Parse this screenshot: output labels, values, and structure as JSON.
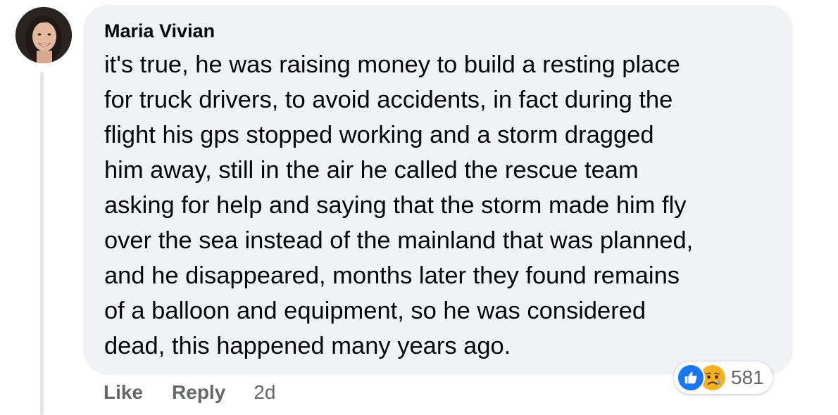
{
  "comment": {
    "author": "Maria Vivian",
    "avatar_icon": "profile-photo",
    "text_lines": [
      "it's true, he was raising money to build a resting place",
      "for truck drivers, to avoid accidents, in fact during the",
      "flight his gps stopped working and a storm dragged",
      "him away, still in the air he called the rescue team",
      "asking for help and saying that the storm made him fly",
      "over the sea instead of the mainland that was planned,",
      "and he disappeared, months later they found remains",
      "of a balloon and equipment, so he was considered",
      "dead, this happened many years ago."
    ]
  },
  "actions": {
    "like_label": "Like",
    "reply_label": "Reply",
    "timestamp": "2d"
  },
  "reactions": {
    "icons": [
      "like-reaction-icon",
      "sad-reaction-icon"
    ],
    "count": "581"
  },
  "colors": {
    "bubble_bg": "#f0f2f5",
    "text": "#050505",
    "secondary_text": "#65676b",
    "like_blue": "#1877f2",
    "sad_yellow": "#f7b125"
  }
}
